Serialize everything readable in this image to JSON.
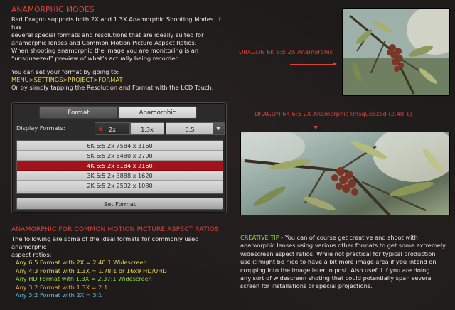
{
  "colors": {
    "accent_red": "#d9433a",
    "highlight_yellow": "#e5d14a",
    "creative_tip_green": "#8fd14a",
    "format_yellow": "#e5d14a",
    "format_green": "#8fd14a",
    "format_orange": "#f0a43a",
    "format_cyan": "#5ec3e0",
    "lcd_selected_red": "#a4131a"
  },
  "left": {
    "title": "ANAMORPHIC MODES",
    "intro_lines": [
      "Red Dragon supports both 2X and 1.3X Anamorphic Shooting Modes.  It has",
      "several special formats and resolutions that are ideally suited for",
      "anamorphic lenses and Common Motion Picture Aspect Ratios.",
      "When shooting anamorphic the image you are monitoring is an",
      "“unsqueezed” preview of what’s actually being recorded."
    ],
    "path_intro": "You can set your format by going to:",
    "menu_path": "MENU>SETTINGS>PROJECT>FORMAT",
    "path_outro": "Or by simply tapping the Resolution and Format with the LCD Touch."
  },
  "lcd": {
    "tabs": [
      {
        "label": "Format",
        "active": false
      },
      {
        "label": "Anamorphic",
        "active": true
      }
    ],
    "display_formats_label": "Display Formats:",
    "options": [
      {
        "label": "2x",
        "selected": true
      },
      {
        "label": "1.3x",
        "selected": false
      }
    ],
    "dropdown_value": "6:5",
    "dropdown_icon": "triangle-down-icon",
    "resolutions": [
      {
        "label": "6K 6:5 2x 7584 x 3160",
        "selected": false
      },
      {
        "label": "5K 6:5 2x 6480 x 2700",
        "selected": false
      },
      {
        "label": "4K 6:5 2x 5184 x 2160",
        "selected": true
      },
      {
        "label": "3K 6:5 2x 3888 x 1620",
        "selected": false
      },
      {
        "label": "2K 6:5 2x 2592 x 1080",
        "selected": false
      }
    ],
    "set_button_label": "Set Format"
  },
  "section2": {
    "title": "ANAMORPHIC FOR COMMON MOTION PICTURE ASPECT RATIOS",
    "intro_lines": [
      "The following are some of the ideal formats for commonly used anamorphic",
      "aspect ratios:"
    ],
    "formats": [
      {
        "text": "Any 6:5 Format with 2X = 2.40:1 Widescreen",
        "color": "#e5d14a"
      },
      {
        "text": "Any 4:3 Format with 1.3X = 1.78:1 or 16x9 HD/UHD",
        "color": "#e5d14a"
      },
      {
        "text": "Any HD Format with 1.3X = 2.37:1 Widescreen",
        "color": "#8fd14a"
      },
      {
        "text": "Any 3:2 Format with 1.3X = 2:1",
        "color": "#f0a43a"
      },
      {
        "text": "Any 3:2 Format with 2X = 3:1",
        "color": "#5ec3e0"
      }
    ]
  },
  "right": {
    "caption_squeezed": "DRAGON 6K 6:5 2X Anamorphic",
    "caption_unsqueezed": "DRAGON 6K 6:5 2X Anamorphic Unsqueezed (2.40:1)",
    "tip_title": "CREATIVE TIP",
    "tip_lines": [
      " - You can of course get creative and shoot with",
      "anamorphic lenses using various other formats to get some extremely",
      "widescreen aspect ratios.  While not practical for typical production",
      "use it might be nice to have a bit more image area if you intend on",
      "cropping into the image later in post.  Also useful if you are doing",
      "any sort of widescreen shoting that could potentially span several",
      "screen for installations or special projections."
    ]
  }
}
